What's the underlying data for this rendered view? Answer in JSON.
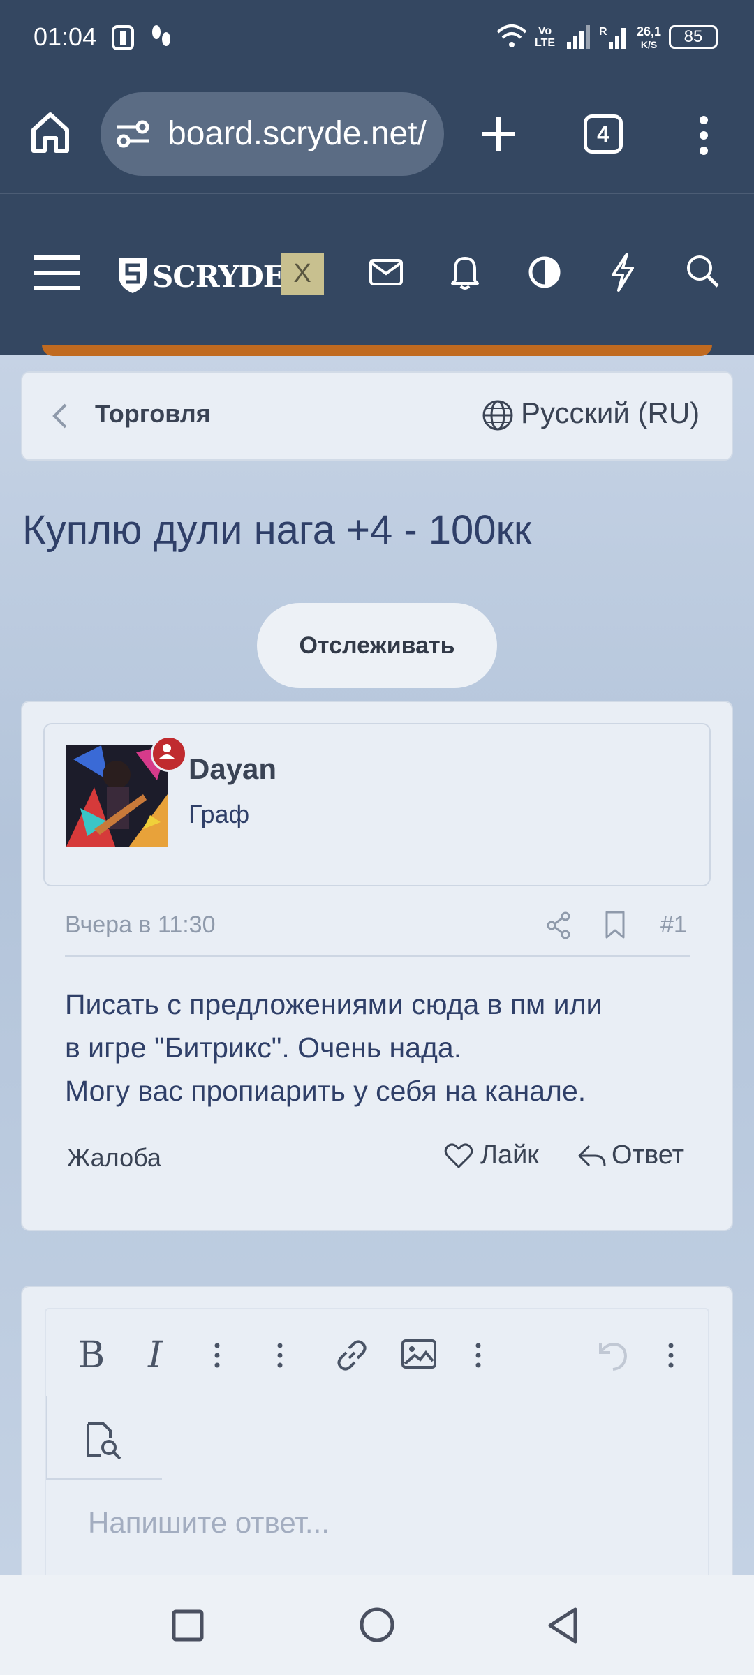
{
  "status_bar": {
    "time": "01:04",
    "net_speed": "26,1",
    "net_unit": "K/S",
    "battery": "85"
  },
  "browser": {
    "url": "board.scryde.net/",
    "tab_count": "4"
  },
  "site": {
    "logo": "SCRYDE",
    "x_badge": "X"
  },
  "breadcrumb": {
    "section": "Торговля",
    "language": "Русский (RU)"
  },
  "thread": {
    "title": "Куплю дули нага +4 - 100кк",
    "watch_button": "Отслеживать"
  },
  "post": {
    "author": "Dayan",
    "rank": "Граф",
    "date": "Вчера в 11:30",
    "number": "#1",
    "body_lines": [
      "Писать с предложениями сюда в пм или",
      "в игре \"Битрикс\". Очень нада.",
      "Могу вас пропиарить у себя на канале."
    ],
    "complaint": "Жалоба",
    "like": "Лайк",
    "reply": "Ответ"
  },
  "editor": {
    "placeholder": "Напишите ответ..."
  },
  "colors": {
    "header_bg": "#344761",
    "accent_title": "#2f3f68",
    "card_bg": "#e9eef5",
    "avatar_badge": "#c02b2f",
    "x_badge_bg": "#c8c08f"
  }
}
